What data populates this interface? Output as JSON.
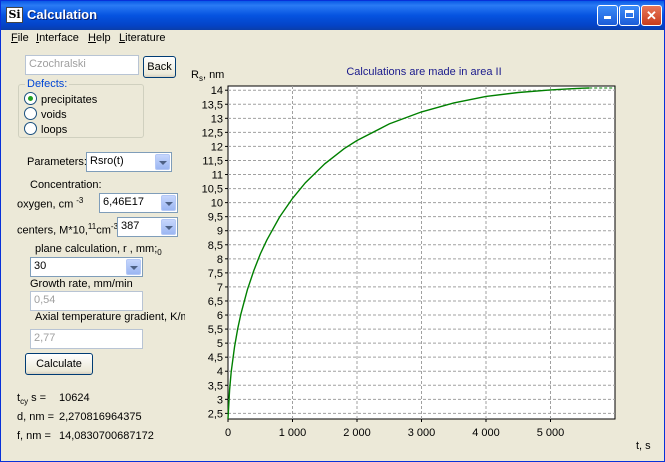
{
  "window": {
    "title": "Calculation",
    "icon_text": "Si"
  },
  "menu": [
    "File",
    "Interface",
    "Help",
    "Literature"
  ],
  "left_panel": {
    "method_field": "Czochralski",
    "back_label": "Back",
    "defects": {
      "label": "Defects:",
      "options": [
        {
          "label": "precipitates",
          "selected": true
        },
        {
          "label": "voids",
          "selected": false
        },
        {
          "label": "loops",
          "selected": false
        }
      ]
    },
    "parameters": {
      "label": "Parameters:",
      "value": "Rsro(t)"
    },
    "concentration_label": "Concentration:",
    "oxygen": {
      "label": "oxygen, cm",
      "sup": "-3",
      "value": "6,46E17"
    },
    "centers": {
      "label": "centers, M*10,",
      "sup1": "11",
      "unit": "cm",
      "sup2": "-3",
      "value": "387"
    },
    "plane": {
      "label": "plane calculation, r , mm;",
      "sub": "0",
      "value": "30"
    },
    "growth_rate": {
      "label": "Growth rate, mm/min",
      "value": "0,54"
    },
    "gradient": {
      "label": "Axial temperature gradient,  K/mm",
      "value": "2,77"
    },
    "calculate_label": "Calculate",
    "results": [
      {
        "label": "t",
        "sub": "cy",
        "suffix": " s =",
        "value": "10624"
      },
      {
        "label": "d, nm =",
        "value": "2,270816964375"
      },
      {
        "label": "f, nm =",
        "value": "14,0830700687172"
      }
    ]
  },
  "chart_data": {
    "type": "line",
    "title": "Calculations are made in area II",
    "ylabel_main": "R",
    "ylabel_sub": "s",
    "ylabel_unit": ", nm",
    "xlabel": "t, s",
    "xlim": [
      0,
      6000
    ],
    "ylim": [
      2.3,
      14.15
    ],
    "x_ticks": [
      0,
      1000,
      2000,
      3000,
      4000,
      5000
    ],
    "x_tick_labels": [
      "0",
      "1 000",
      "2 000",
      "3 000",
      "4 000",
      "5 000"
    ],
    "y_ticks": [
      2.5,
      3,
      3.5,
      4,
      4.5,
      5,
      5.5,
      6,
      6.5,
      7,
      7.5,
      8,
      8.5,
      9,
      9.5,
      10,
      10.5,
      11,
      11.5,
      12,
      12.5,
      13,
      13.5,
      14
    ],
    "y_tick_labels": [
      "2,5",
      "3",
      "3,5",
      "4",
      "4,5",
      "5",
      "5,5",
      "6",
      "6,5",
      "7",
      "7,5",
      "8",
      "8,5",
      "9",
      "9,5",
      "10",
      "10,5",
      "11",
      "11,5",
      "12",
      "12,5",
      "13",
      "13,5",
      "14"
    ],
    "grid": true,
    "line_color": "#008000",
    "series": [
      {
        "x": [
          0,
          25,
          50,
          100,
          150,
          200,
          300,
          400,
          500,
          600,
          800,
          1000,
          1200,
          1500,
          1800,
          2000,
          2500,
          3000,
          3500,
          4000,
          4500,
          5000,
          5300,
          5500,
          5600
        ],
        "y": [
          2.3,
          3.34,
          3.98,
          4.86,
          5.51,
          6.04,
          6.9,
          7.58,
          8.17,
          8.66,
          9.49,
          10.15,
          10.71,
          11.38,
          11.92,
          12.21,
          12.8,
          13.23,
          13.55,
          13.78,
          13.92,
          14.01,
          14.05,
          14.07,
          14.08
        ]
      }
    ]
  }
}
